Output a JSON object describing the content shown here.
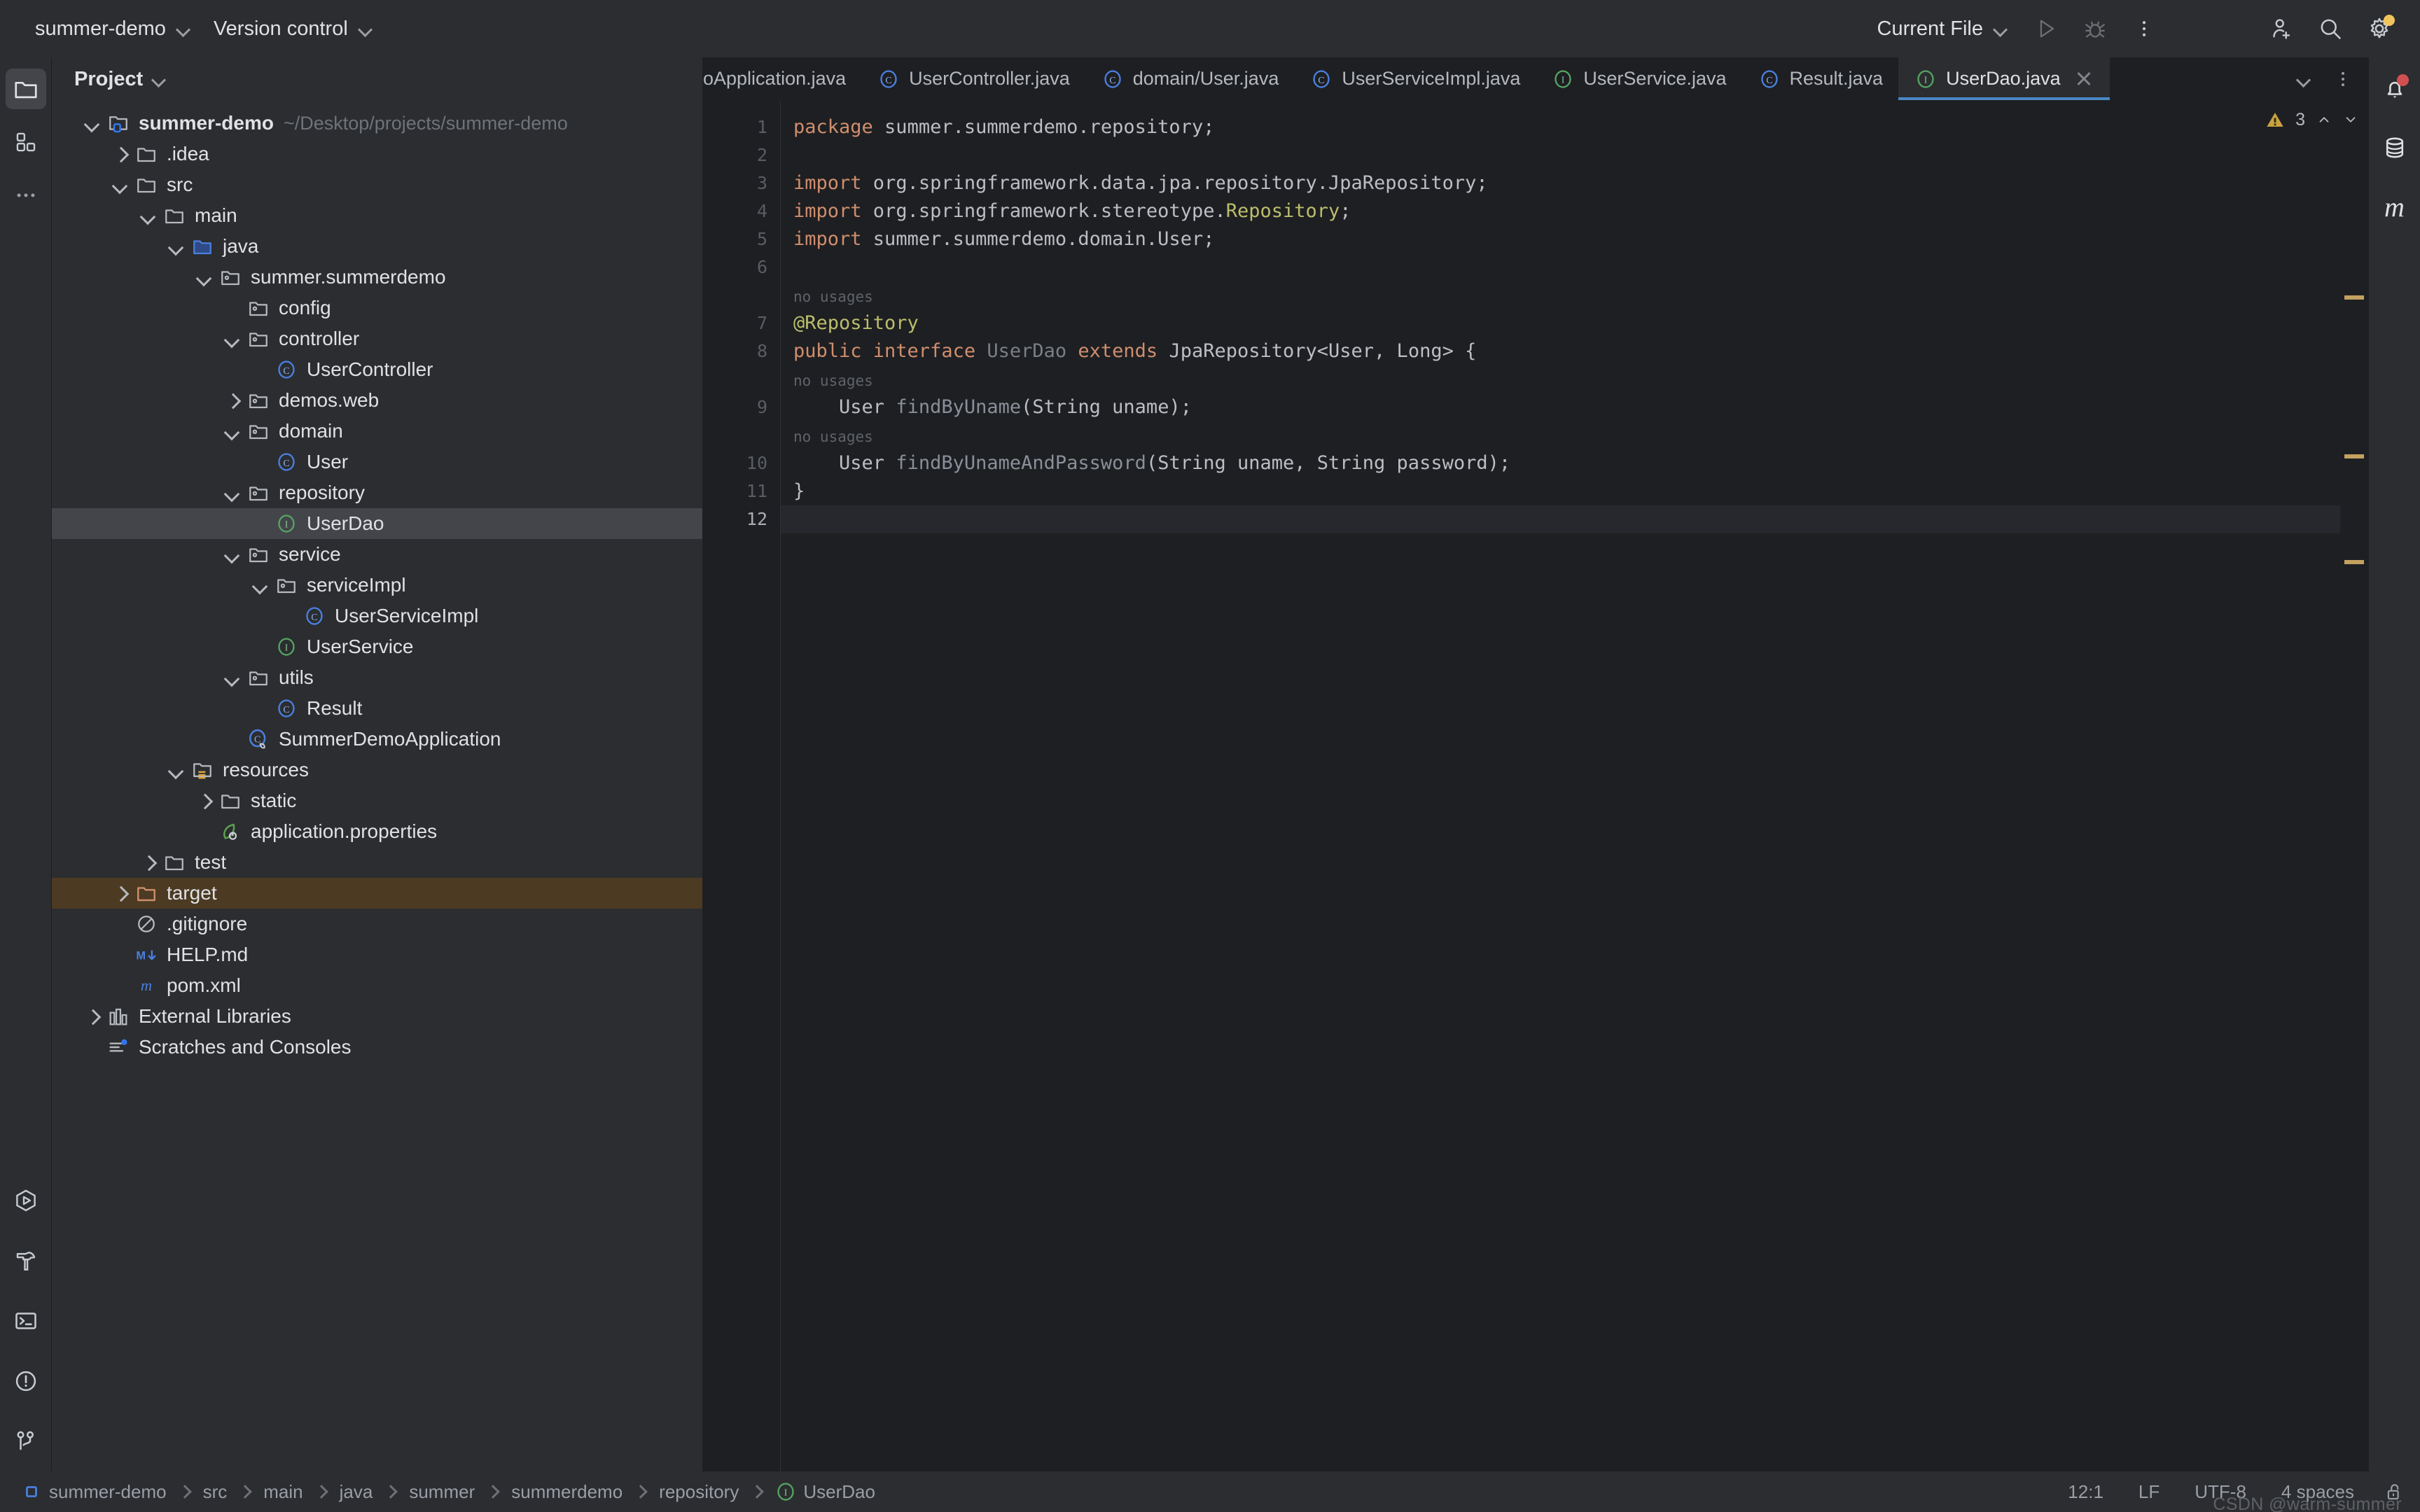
{
  "topbar": {
    "project_name": "summer-demo",
    "version_control": "Version control",
    "run_config": "Current File",
    "run_icon": "run-play-icon",
    "debug_icon": "debug-bug-icon",
    "more_icon": "more-vertical-icon",
    "account_icon": "add-user-icon",
    "search_icon": "search-icon",
    "settings_icon": "gear-icon"
  },
  "left_rail": {
    "items": [
      {
        "name": "project-tool-window",
        "icon": "folder-icon",
        "active": true
      },
      {
        "name": "commit-tool-window",
        "icon": "grid-blocks-icon",
        "active": false
      },
      {
        "name": "more-tool-windows",
        "icon": "ellipsis-icon",
        "active": false
      }
    ],
    "bottom_items": [
      {
        "name": "run-tool-window",
        "icon": "run-hexagon-icon"
      },
      {
        "name": "build-tool-window",
        "icon": "hammer-icon"
      },
      {
        "name": "terminal-tool-window",
        "icon": "terminal-icon"
      },
      {
        "name": "problems-tool-window",
        "icon": "exclamation-circle-icon"
      },
      {
        "name": "git-tool-window",
        "icon": "git-branch-icon"
      }
    ]
  },
  "right_rail": {
    "items": [
      {
        "name": "notifications",
        "icon": "bell-icon",
        "badge": true
      },
      {
        "name": "database",
        "icon": "database-icon"
      },
      {
        "name": "maven",
        "icon": "maven-m-icon"
      }
    ]
  },
  "project_panel": {
    "title": "Project",
    "tree": [
      {
        "depth": 0,
        "twisty": "down",
        "icon": "module-folder-icon",
        "label": "summer-demo",
        "bold": true,
        "sub": "~/Desktop/projects/summer-demo"
      },
      {
        "depth": 1,
        "twisty": "right",
        "icon": "folder-icon",
        "label": ".idea"
      },
      {
        "depth": 1,
        "twisty": "down",
        "icon": "folder-icon",
        "label": "src"
      },
      {
        "depth": 2,
        "twisty": "down",
        "icon": "folder-icon",
        "label": "main"
      },
      {
        "depth": 3,
        "twisty": "down",
        "icon": "source-folder-icon",
        "label": "java"
      },
      {
        "depth": 4,
        "twisty": "down",
        "icon": "package-icon",
        "label": "summer.summerdemo"
      },
      {
        "depth": 5,
        "twisty": "none",
        "icon": "package-icon",
        "label": "config"
      },
      {
        "depth": 5,
        "twisty": "down",
        "icon": "package-icon",
        "label": "controller"
      },
      {
        "depth": 6,
        "twisty": "none",
        "icon": "class-icon",
        "label": "UserController"
      },
      {
        "depth": 5,
        "twisty": "right",
        "icon": "package-icon",
        "label": "demos.web"
      },
      {
        "depth": 5,
        "twisty": "down",
        "icon": "package-icon",
        "label": "domain"
      },
      {
        "depth": 6,
        "twisty": "none",
        "icon": "class-icon",
        "label": "User"
      },
      {
        "depth": 5,
        "twisty": "down",
        "icon": "package-icon",
        "label": "repository"
      },
      {
        "depth": 6,
        "twisty": "none",
        "icon": "interface-icon",
        "label": "UserDao",
        "state": "selected"
      },
      {
        "depth": 5,
        "twisty": "down",
        "icon": "package-icon",
        "label": "service"
      },
      {
        "depth": 6,
        "twisty": "down",
        "icon": "package-icon",
        "label": "serviceImpl"
      },
      {
        "depth": 7,
        "twisty": "none",
        "icon": "class-icon",
        "label": "UserServiceImpl"
      },
      {
        "depth": 6,
        "twisty": "none",
        "icon": "interface-icon",
        "label": "UserService"
      },
      {
        "depth": 5,
        "twisty": "down",
        "icon": "package-icon",
        "label": "utils"
      },
      {
        "depth": 6,
        "twisty": "none",
        "icon": "class-icon",
        "label": "Result"
      },
      {
        "depth": 5,
        "twisty": "none",
        "icon": "spring-class-icon",
        "label": "SummerDemoApplication"
      },
      {
        "depth": 3,
        "twisty": "down",
        "icon": "resources-folder-icon",
        "label": "resources"
      },
      {
        "depth": 4,
        "twisty": "right",
        "icon": "folder-icon",
        "label": "static"
      },
      {
        "depth": 4,
        "twisty": "none",
        "icon": "spring-properties-icon",
        "label": "application.properties"
      },
      {
        "depth": 2,
        "twisty": "right",
        "icon": "folder-icon",
        "label": "test"
      },
      {
        "depth": 1,
        "twisty": "right",
        "icon": "excluded-folder-icon",
        "label": "target",
        "state": "excluded-highlight"
      },
      {
        "depth": 1,
        "twisty": "none",
        "icon": "gitignore-icon",
        "label": ".gitignore"
      },
      {
        "depth": 1,
        "twisty": "none",
        "icon": "markdown-icon",
        "label": "HELP.md"
      },
      {
        "depth": 1,
        "twisty": "none",
        "icon": "maven-m-icon",
        "label": "pom.xml"
      },
      {
        "depth": 0,
        "twisty": "right",
        "icon": "libraries-icon",
        "label": "External Libraries"
      },
      {
        "depth": 0,
        "twisty": "none",
        "icon": "scratches-icon",
        "label": "Scratches and Consoles"
      }
    ]
  },
  "editor": {
    "tabs": [
      {
        "label": "oApplication.java",
        "icon": "none",
        "active": false,
        "clipped": true
      },
      {
        "label": "UserController.java",
        "icon": "class-icon",
        "active": false
      },
      {
        "label": "domain/User.java",
        "icon": "class-icon",
        "active": false
      },
      {
        "label": "UserServiceImpl.java",
        "icon": "class-icon",
        "active": false
      },
      {
        "label": "UserService.java",
        "icon": "interface-icon",
        "active": false
      },
      {
        "label": "Result.java",
        "icon": "class-icon",
        "active": false
      },
      {
        "label": "UserDao.java",
        "icon": "interface-icon",
        "active": true,
        "closable": true
      }
    ],
    "tab_actions": [
      {
        "name": "tab-list-chevron",
        "icon": "chevron-down-icon"
      },
      {
        "name": "tab-options",
        "icon": "more-vertical-icon"
      }
    ],
    "inspection": {
      "warning_icon": "warning-triangle-icon",
      "warning_count": "3",
      "up_icon": "chevron-up-icon",
      "down_icon": "chevron-down-icon"
    },
    "line_numbers": [
      "1",
      "2",
      "3",
      "4",
      "5",
      "6",
      "7",
      "8",
      "9",
      "10",
      "11",
      "12"
    ],
    "current_line": "12",
    "lines": [
      {
        "n": "1",
        "tokens": [
          {
            "t": "package",
            "c": "kw"
          },
          {
            "t": " summer.summerdemo.repository;",
            "c": "ident"
          }
        ]
      },
      {
        "n": "2",
        "tokens": []
      },
      {
        "n": "3",
        "tokens": [
          {
            "t": "import",
            "c": "kw"
          },
          {
            "t": " org.springframework.data.jpa.repository.JpaRepository;",
            "c": "ident"
          }
        ]
      },
      {
        "n": "4",
        "tokens": [
          {
            "t": "import",
            "c": "kw"
          },
          {
            "t": " org.springframework.stereotype.",
            "c": "ident"
          },
          {
            "t": "Repository",
            "c": "ann"
          },
          {
            "t": ";",
            "c": "ident"
          }
        ]
      },
      {
        "n": "5",
        "tokens": [
          {
            "t": "import",
            "c": "kw"
          },
          {
            "t": " summer.summerdemo.domain.User;",
            "c": "ident"
          }
        ]
      },
      {
        "n": "6",
        "tokens": []
      },
      {
        "n": "7",
        "tokens": [
          {
            "t": "@Repository",
            "c": "ann"
          }
        ],
        "hint": "no usages"
      },
      {
        "n": "8",
        "tokens": [
          {
            "t": "public interface ",
            "c": "kw"
          },
          {
            "t": "UserDao",
            "c": "dim"
          },
          {
            "t": " extends ",
            "c": "kw"
          },
          {
            "t": "JpaRepository<User, Long> {",
            "c": "ident"
          }
        ],
        "gutter_icon": "interface-impl-icon"
      },
      {
        "n": "9",
        "tokens": [
          {
            "t": "    User ",
            "c": "ident"
          },
          {
            "t": "findByUname",
            "c": "fn"
          },
          {
            "t": "(String uname);",
            "c": "ident"
          }
        ],
        "hint": "no usages"
      },
      {
        "n": "10",
        "tokens": [
          {
            "t": "    User ",
            "c": "ident"
          },
          {
            "t": "findByUnameAndPassword",
            "c": "fn"
          },
          {
            "t": "(String uname, String password);",
            "c": "ident"
          }
        ],
        "hint": "no usages"
      },
      {
        "n": "11",
        "tokens": [
          {
            "t": "}",
            "c": "ident"
          }
        ]
      },
      {
        "n": "12",
        "tokens": [],
        "current": true
      }
    ],
    "markers": [
      {
        "name": "warning-marker-1",
        "top_pct": 14.2
      },
      {
        "name": "warning-marker-2",
        "top_pct": 25.8
      },
      {
        "name": "warning-marker-3",
        "top_pct": 33.5
      }
    ]
  },
  "status_bar": {
    "breadcrumb": [
      {
        "label": "summer-demo",
        "icon": "module-square-icon"
      },
      {
        "label": "src",
        "icon": "none"
      },
      {
        "label": "main",
        "icon": "none"
      },
      {
        "label": "java",
        "icon": "none"
      },
      {
        "label": "summer",
        "icon": "none"
      },
      {
        "label": "summerdemo",
        "icon": "none"
      },
      {
        "label": "repository",
        "icon": "none"
      },
      {
        "label": "UserDao",
        "icon": "interface-icon"
      }
    ],
    "caret_position": "12:1",
    "line_separator": "LF",
    "encoding": "UTF-8",
    "indent": "4 spaces",
    "lock_icon": "unlocked-icon",
    "watermark": "CSDN @warm-summer"
  },
  "colors": {
    "bg_panel": "#2b2d30",
    "bg_editor": "#1e1f22",
    "selection": "#43454a",
    "excluded": "#4c3a22",
    "accent_blue": "#3574f0",
    "keyword_orange": "#cf8e6d",
    "annotation_yellow": "#bcbe6b",
    "warning_yellow": "#c3a160",
    "interface_green": "#55a362"
  }
}
